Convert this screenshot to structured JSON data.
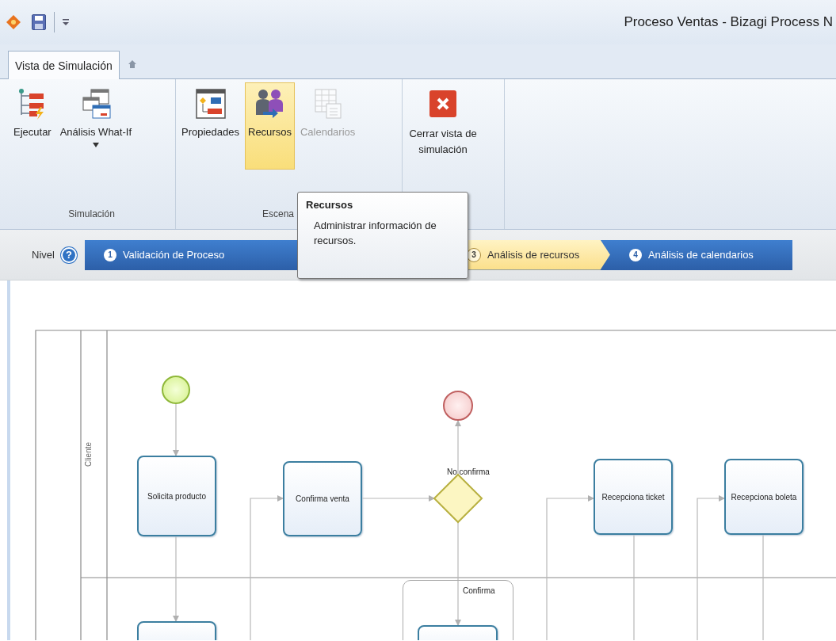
{
  "window": {
    "title": "Proceso Ventas - Bizagi Process N"
  },
  "tabs": [
    {
      "label": "Vista de Simulación",
      "selected": true
    }
  ],
  "ribbon": {
    "groups": [
      {
        "label": "Simulación",
        "buttons": [
          {
            "label": "Ejecutar",
            "selected": false,
            "disabled": false
          },
          {
            "label": "Análisis What-If",
            "selected": false,
            "disabled": false,
            "dropdown": true
          }
        ]
      },
      {
        "label": "Escena",
        "buttons": [
          {
            "label": "Propiedades",
            "selected": false,
            "disabled": false
          },
          {
            "label": "Recursos",
            "selected": true,
            "disabled": false
          },
          {
            "label": "Calendarios",
            "selected": false,
            "disabled": true
          }
        ]
      },
      {
        "buttons": [
          {
            "label": "Cerrar vista de simulación",
            "selected": false,
            "disabled": false
          }
        ]
      }
    ]
  },
  "levels": {
    "label": "Nivel",
    "help": "?",
    "steps": [
      {
        "number": "1",
        "label": "Validación de Proceso",
        "selected": false
      },
      {
        "number": "3",
        "label": "Análisis de recursos",
        "selected": true
      },
      {
        "number": "4",
        "label": "Análisis de calendarios",
        "selected": false
      }
    ]
  },
  "tooltip": {
    "title": "Recursos",
    "text": "Administrar información de recursos."
  },
  "diagram": {
    "lanes": [
      {
        "label": "Cliente"
      }
    ],
    "nodes": [
      {
        "kind": "start"
      },
      {
        "kind": "task",
        "label": "Solicita producto"
      },
      {
        "kind": "task",
        "label": "Confirma venta"
      },
      {
        "kind": "gateway"
      },
      {
        "kind": "end"
      },
      {
        "kind": "task",
        "label": "Recepciona ticket"
      },
      {
        "kind": "task",
        "label": "Recepciona boleta"
      },
      {
        "kind": "group"
      },
      {
        "kind": "task"
      },
      {
        "kind": "task"
      }
    ],
    "labels": [
      {
        "text": "No confirma"
      },
      {
        "text": "Confirma"
      }
    ]
  }
}
